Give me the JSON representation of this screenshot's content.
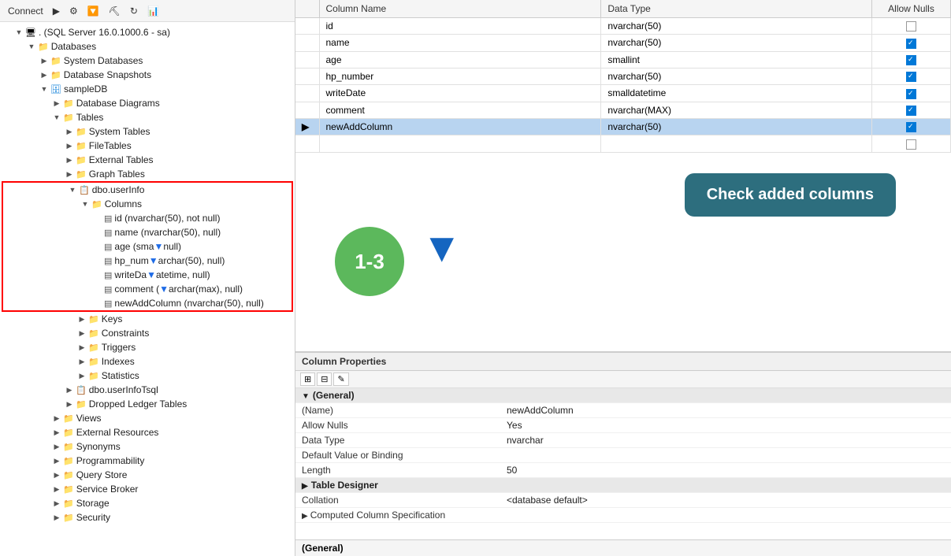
{
  "toolbar": {
    "connect_label": "Connect",
    "buttons": [
      "▶",
      "⚙",
      "🔽",
      "⛏",
      "↻",
      "📊"
    ]
  },
  "tree": {
    "server": ". (SQL Server 16.0.1000.6 - sa)",
    "items": [
      {
        "label": "Databases",
        "indent": 1,
        "type": "folder",
        "expanded": true
      },
      {
        "label": "System Databases",
        "indent": 2,
        "type": "folder",
        "expanded": false
      },
      {
        "label": "Database Snapshots",
        "indent": 2,
        "type": "folder",
        "expanded": false
      },
      {
        "label": "sampleDB",
        "indent": 2,
        "type": "db",
        "expanded": true
      },
      {
        "label": "Database Diagrams",
        "indent": 3,
        "type": "folder",
        "expanded": false
      },
      {
        "label": "Tables",
        "indent": 3,
        "type": "folder",
        "expanded": true
      },
      {
        "label": "System Tables",
        "indent": 4,
        "type": "folder",
        "expanded": false
      },
      {
        "label": "FileTables",
        "indent": 4,
        "type": "folder",
        "expanded": false
      },
      {
        "label": "External Tables",
        "indent": 4,
        "type": "folder",
        "expanded": false
      },
      {
        "label": "Graph Tables",
        "indent": 4,
        "type": "folder",
        "expanded": false
      },
      {
        "label": "dbo.userInfo",
        "indent": 4,
        "type": "table",
        "expanded": true,
        "highlight": true
      },
      {
        "label": "Columns",
        "indent": 5,
        "type": "folder",
        "expanded": true,
        "highlight": true
      },
      {
        "label": "id (nvarchar(50), not null)",
        "indent": 6,
        "type": "col",
        "highlight": true
      },
      {
        "label": "name (nvarchar(50), null)",
        "indent": 6,
        "type": "col",
        "highlight": true
      },
      {
        "label": "age (smallint, null)",
        "indent": 6,
        "type": "col",
        "highlight": true
      },
      {
        "label": "hp_number (nvarchar(50), null)",
        "indent": 6,
        "type": "col",
        "highlight": true
      },
      {
        "label": "writeDate (smalldatetime, null)",
        "indent": 6,
        "type": "col",
        "highlight": true
      },
      {
        "label": "comment (nvarchar(max), null)",
        "indent": 6,
        "type": "col",
        "highlight": true
      },
      {
        "label": "newAddColumn (nvarchar(50), null)",
        "indent": 6,
        "type": "col",
        "highlight": true
      },
      {
        "label": "Keys",
        "indent": 5,
        "type": "folder",
        "expanded": false
      },
      {
        "label": "Constraints",
        "indent": 5,
        "type": "folder",
        "expanded": false
      },
      {
        "label": "Triggers",
        "indent": 5,
        "type": "folder",
        "expanded": false
      },
      {
        "label": "Indexes",
        "indent": 5,
        "type": "folder",
        "expanded": false
      },
      {
        "label": "Statistics",
        "indent": 5,
        "type": "folder",
        "expanded": false
      },
      {
        "label": "dbo.userInfoTsql",
        "indent": 4,
        "type": "table",
        "expanded": false
      },
      {
        "label": "Dropped Ledger Tables",
        "indent": 4,
        "type": "folder",
        "expanded": false
      },
      {
        "label": "Views",
        "indent": 3,
        "type": "folder",
        "expanded": false
      },
      {
        "label": "External Resources",
        "indent": 3,
        "type": "folder",
        "expanded": false
      },
      {
        "label": "Synonyms",
        "indent": 3,
        "type": "folder",
        "expanded": false
      },
      {
        "label": "Programmability",
        "indent": 3,
        "type": "folder",
        "expanded": false
      },
      {
        "label": "Query Store",
        "indent": 3,
        "type": "folder",
        "expanded": false
      },
      {
        "label": "Service Broker",
        "indent": 3,
        "type": "folder",
        "expanded": false
      },
      {
        "label": "Storage",
        "indent": 3,
        "type": "folder",
        "expanded": false
      },
      {
        "label": "Security",
        "indent": 3,
        "type": "folder",
        "expanded": false
      }
    ]
  },
  "table_designer": {
    "columns": {
      "headers": [
        "Column Name",
        "Data Type",
        "Allow Nulls"
      ],
      "rows": [
        {
          "name": "id",
          "datatype": "nvarchar(50)",
          "allownulls": false,
          "selected": false,
          "arrow": false
        },
        {
          "name": "name",
          "datatype": "nvarchar(50)",
          "allownulls": true,
          "selected": false,
          "arrow": false
        },
        {
          "name": "age",
          "datatype": "smallint",
          "allownulls": true,
          "selected": false,
          "arrow": false
        },
        {
          "name": "hp_number",
          "datatype": "nvarchar(50)",
          "allownulls": true,
          "selected": false,
          "arrow": false
        },
        {
          "name": "writeDate",
          "datatype": "smalldatetime",
          "allownulls": true,
          "selected": false,
          "arrow": false
        },
        {
          "name": "comment",
          "datatype": "nvarchar(MAX)",
          "allownulls": true,
          "selected": false,
          "arrow": false
        },
        {
          "name": "newAddColumn",
          "datatype": "nvarchar(50)",
          "allownulls": true,
          "selected": true,
          "arrow": true
        }
      ]
    }
  },
  "overlay": {
    "check_label": "Check added columns",
    "number_label": "1-3"
  },
  "col_properties": {
    "header": "Column Properties",
    "toolbar_buttons": [
      "⊞",
      "⊟",
      "✎"
    ],
    "general_section": "(General)",
    "name_label": "(Name)",
    "name_value": "newAddColumn",
    "allow_nulls_label": "Allow Nulls",
    "allow_nulls_value": "Yes",
    "data_type_label": "Data Type",
    "data_type_value": "nvarchar",
    "default_label": "Default Value or Binding",
    "default_value": "",
    "length_label": "Length",
    "length_value": "50",
    "table_designer_section": "Table Designer",
    "collation_label": "Collation",
    "collation_value": "<database default>",
    "computed_col_label": "Computed Column Specification",
    "computed_col_value": "",
    "general_bottom": "(General)"
  }
}
